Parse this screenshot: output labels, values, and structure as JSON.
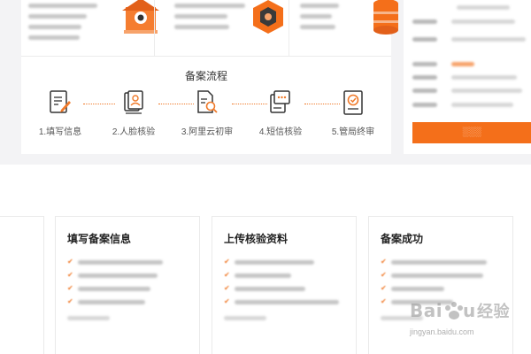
{
  "process": {
    "title": "备案流程",
    "steps": [
      {
        "label": "1.填写信息",
        "icon": "form-edit-icon"
      },
      {
        "label": "2.人脸核验",
        "icon": "face-id-icon"
      },
      {
        "label": "3.阿里云初审",
        "icon": "document-search-icon"
      },
      {
        "label": "4.短信核验",
        "icon": "message-verify-icon"
      },
      {
        "label": "5.管局终审",
        "icon": "approval-badge-icon"
      }
    ]
  },
  "cards": [
    {
      "title": "填写备案信息"
    },
    {
      "title": "上传核验资料"
    },
    {
      "title": "备案成功"
    }
  ],
  "watermark": {
    "url": "jingyan.baidu.com"
  },
  "colors": {
    "accent": "#f46f1a",
    "dotted": "#f07a2a",
    "bg": "#f3f3f5"
  }
}
